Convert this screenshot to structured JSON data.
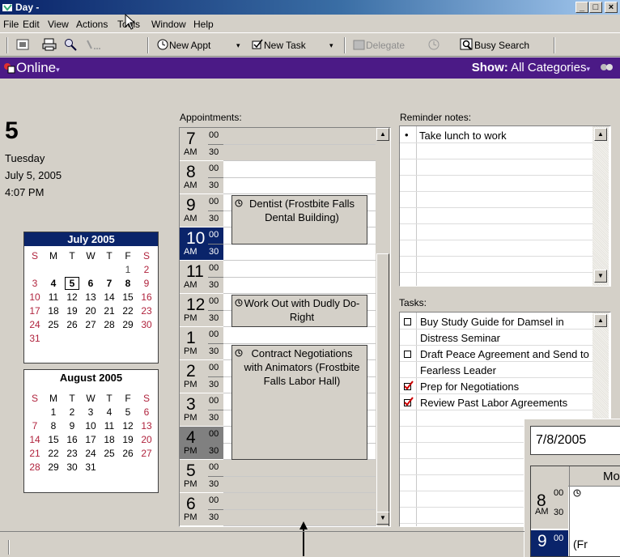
{
  "titlebar": {
    "title": "Day -",
    "min": "_",
    "max": "□",
    "close": "×"
  },
  "menu": [
    "File",
    "Edit",
    "View",
    "Actions",
    "Tools",
    "Window",
    "Help"
  ],
  "toolbar": {
    "new_appt": "New Appt",
    "new_task": "New Task",
    "delegate": "Delegate",
    "busy_search": "Busy Search",
    "dropdown_arrow": "▾"
  },
  "online_bar": {
    "label": "Online",
    "show_label": "Show:",
    "show_value": "All Categories"
  },
  "date_info": {
    "day_number": "5",
    "weekday": "Tuesday",
    "date": "July 5, 2005",
    "time": "4:07 PM"
  },
  "mini_cal_july": {
    "title": "July 2005",
    "dow": [
      "S",
      "M",
      "T",
      "W",
      "T",
      "F",
      "S"
    ],
    "weeks": [
      [
        "",
        "",
        "",
        "",
        "",
        "1",
        "2"
      ],
      [
        "3",
        "4",
        "5",
        "6",
        "7",
        "8",
        "9"
      ],
      [
        "10",
        "11",
        "12",
        "13",
        "14",
        "15",
        "16"
      ],
      [
        "17",
        "18",
        "19",
        "20",
        "21",
        "22",
        "23"
      ],
      [
        "24",
        "25",
        "26",
        "27",
        "28",
        "29",
        "30"
      ],
      [
        "31",
        "",
        "",
        "",
        "",
        "",
        ""
      ]
    ]
  },
  "mini_cal_august": {
    "title": "August 2005",
    "dow": [
      "S",
      "M",
      "T",
      "W",
      "T",
      "F",
      "S"
    ],
    "weeks": [
      [
        "",
        "1",
        "2",
        "3",
        "4",
        "5",
        "6"
      ],
      [
        "7",
        "8",
        "9",
        "10",
        "11",
        "12",
        "13"
      ],
      [
        "14",
        "15",
        "16",
        "17",
        "18",
        "19",
        "20"
      ],
      [
        "21",
        "22",
        "23",
        "24",
        "25",
        "26",
        "27"
      ],
      [
        "28",
        "29",
        "30",
        "31",
        "",
        "",
        ""
      ]
    ]
  },
  "appointments": {
    "label": "Appointments:",
    "hours": [
      {
        "h": "7",
        "ap": "AM"
      },
      {
        "h": "8",
        "ap": "AM"
      },
      {
        "h": "9",
        "ap": "AM"
      },
      {
        "h": "10",
        "ap": "AM"
      },
      {
        "h": "11",
        "ap": "AM"
      },
      {
        "h": "12",
        "ap": "PM"
      },
      {
        "h": "1",
        "ap": "PM"
      },
      {
        "h": "2",
        "ap": "PM"
      },
      {
        "h": "3",
        "ap": "PM"
      },
      {
        "h": "4",
        "ap": "PM"
      },
      {
        "h": "5",
        "ap": "PM"
      },
      {
        "h": "6",
        "ap": "PM"
      }
    ],
    "min00": "00",
    "min30": "30",
    "items": [
      {
        "text": "Dentist  (Frostbite Falls Dental Building)"
      },
      {
        "text": "Work Out with Dudly Do-Right"
      },
      {
        "text": "Contract Negotiations with Animators (Frostbite Falls Labor Hall)"
      }
    ]
  },
  "reminders": {
    "label": "Reminder notes:",
    "items": [
      "Take lunch to work"
    ]
  },
  "tasks": {
    "label": "Tasks:",
    "items": [
      {
        "text": "Buy Study Guide for Damsel in Distress Seminar",
        "done": false
      },
      {
        "text": "Draft Peace Agreement and Send to Fearless Leader",
        "done": false
      },
      {
        "text": "Prep for Negotiations",
        "done": true
      },
      {
        "text": "Review Past Labor Agreements",
        "done": true
      }
    ]
  },
  "overlay": {
    "date": "7/8/2005",
    "col_header": "Mo",
    "h8": "8",
    "ap8": "AM",
    "m00": "00",
    "m30": "30",
    "h9": "9",
    "m9": "00",
    "fr": "(Fr"
  },
  "colors": {
    "title_blue": "#0a246a",
    "online_purple": "#4b1a86",
    "selected_hour": "#0a246a",
    "current_hour": "#808080",
    "task_check_red": "#cc0000"
  }
}
